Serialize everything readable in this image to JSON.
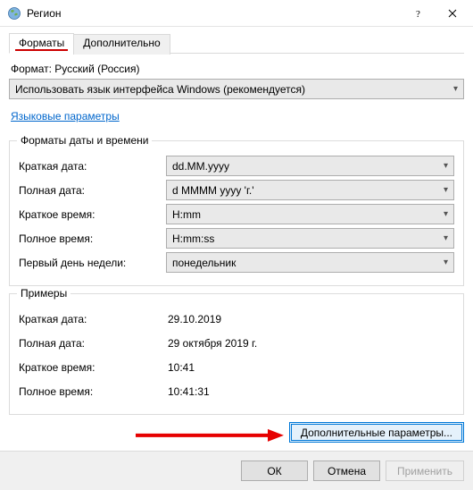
{
  "window": {
    "title": "Регион"
  },
  "tabs": {
    "formats": "Форматы",
    "advanced": "Дополнительно"
  },
  "format": {
    "label": "Формат: Русский (Россия)",
    "dropdown_value": "Использовать язык интерфейса Windows (рекомендуется)"
  },
  "language_link": "Языковые параметры",
  "formats_group": {
    "legend": "Форматы даты и времени",
    "short_date_label": "Краткая дата:",
    "short_date_value": "dd.MM.yyyy",
    "long_date_label": "Полная дата:",
    "long_date_value": "d MMMM yyyy 'г.'",
    "short_time_label": "Краткое время:",
    "short_time_value": "H:mm",
    "long_time_label": "Полное время:",
    "long_time_value": "H:mm:ss",
    "first_day_label": "Первый день недели:",
    "first_day_value": "понедельник"
  },
  "examples_group": {
    "legend": "Примеры",
    "short_date_label": "Краткая дата:",
    "short_date_value": "29.10.2019",
    "long_date_label": "Полная дата:",
    "long_date_value": "29 октября 2019 г.",
    "short_time_label": "Краткое время:",
    "short_time_value": "10:41",
    "long_time_label": "Полное время:",
    "long_time_value": "10:41:31"
  },
  "more_settings_btn": "Дополнительные параметры...",
  "footer": {
    "ok": "ОК",
    "cancel": "Отмена",
    "apply": "Применить"
  }
}
